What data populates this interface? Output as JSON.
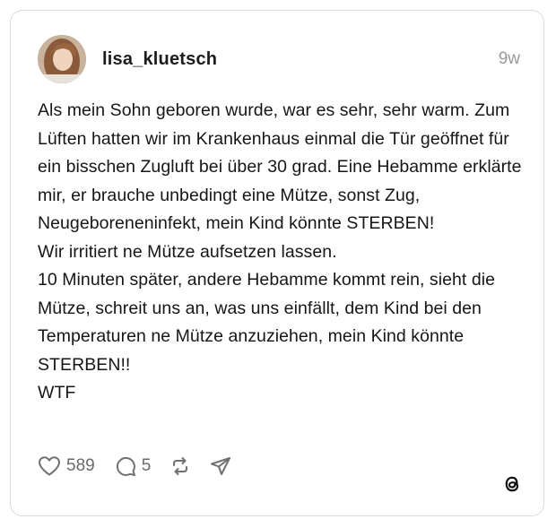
{
  "post": {
    "username": "lisa_kluetsch",
    "time": "9w",
    "text": "Als mein Sohn geboren wurde, war es sehr, sehr warm. Zum Lüften hatten wir im Krankenhaus einmal die Tür geöffnet für ein bisschen Zugluft bei über 30 grad. Eine Hebamme erklärte mir, er brauche unbedingt eine Mütze, sonst Zug, Neugeboreneninfekt, mein Kind könnte STERBEN!\nWir irritiert ne Mütze aufsetzen lassen.\n10 Minuten später, andere Hebamme kommt rein, sieht die Mütze, schreit uns an, was uns einfällt, dem Kind bei den Temperaturen ne Mütze anzuziehen, mein Kind könnte STERBEN!!\nWTF",
    "likes": "589",
    "replies": "5"
  },
  "icons": {
    "like": "heart-icon",
    "reply": "comment-icon",
    "repost": "repost-icon",
    "share": "send-icon",
    "brand": "threads-logo-icon"
  },
  "colors": {
    "text": "#161616",
    "muted": "#9a9a9a",
    "border": "#dcdcdc"
  }
}
